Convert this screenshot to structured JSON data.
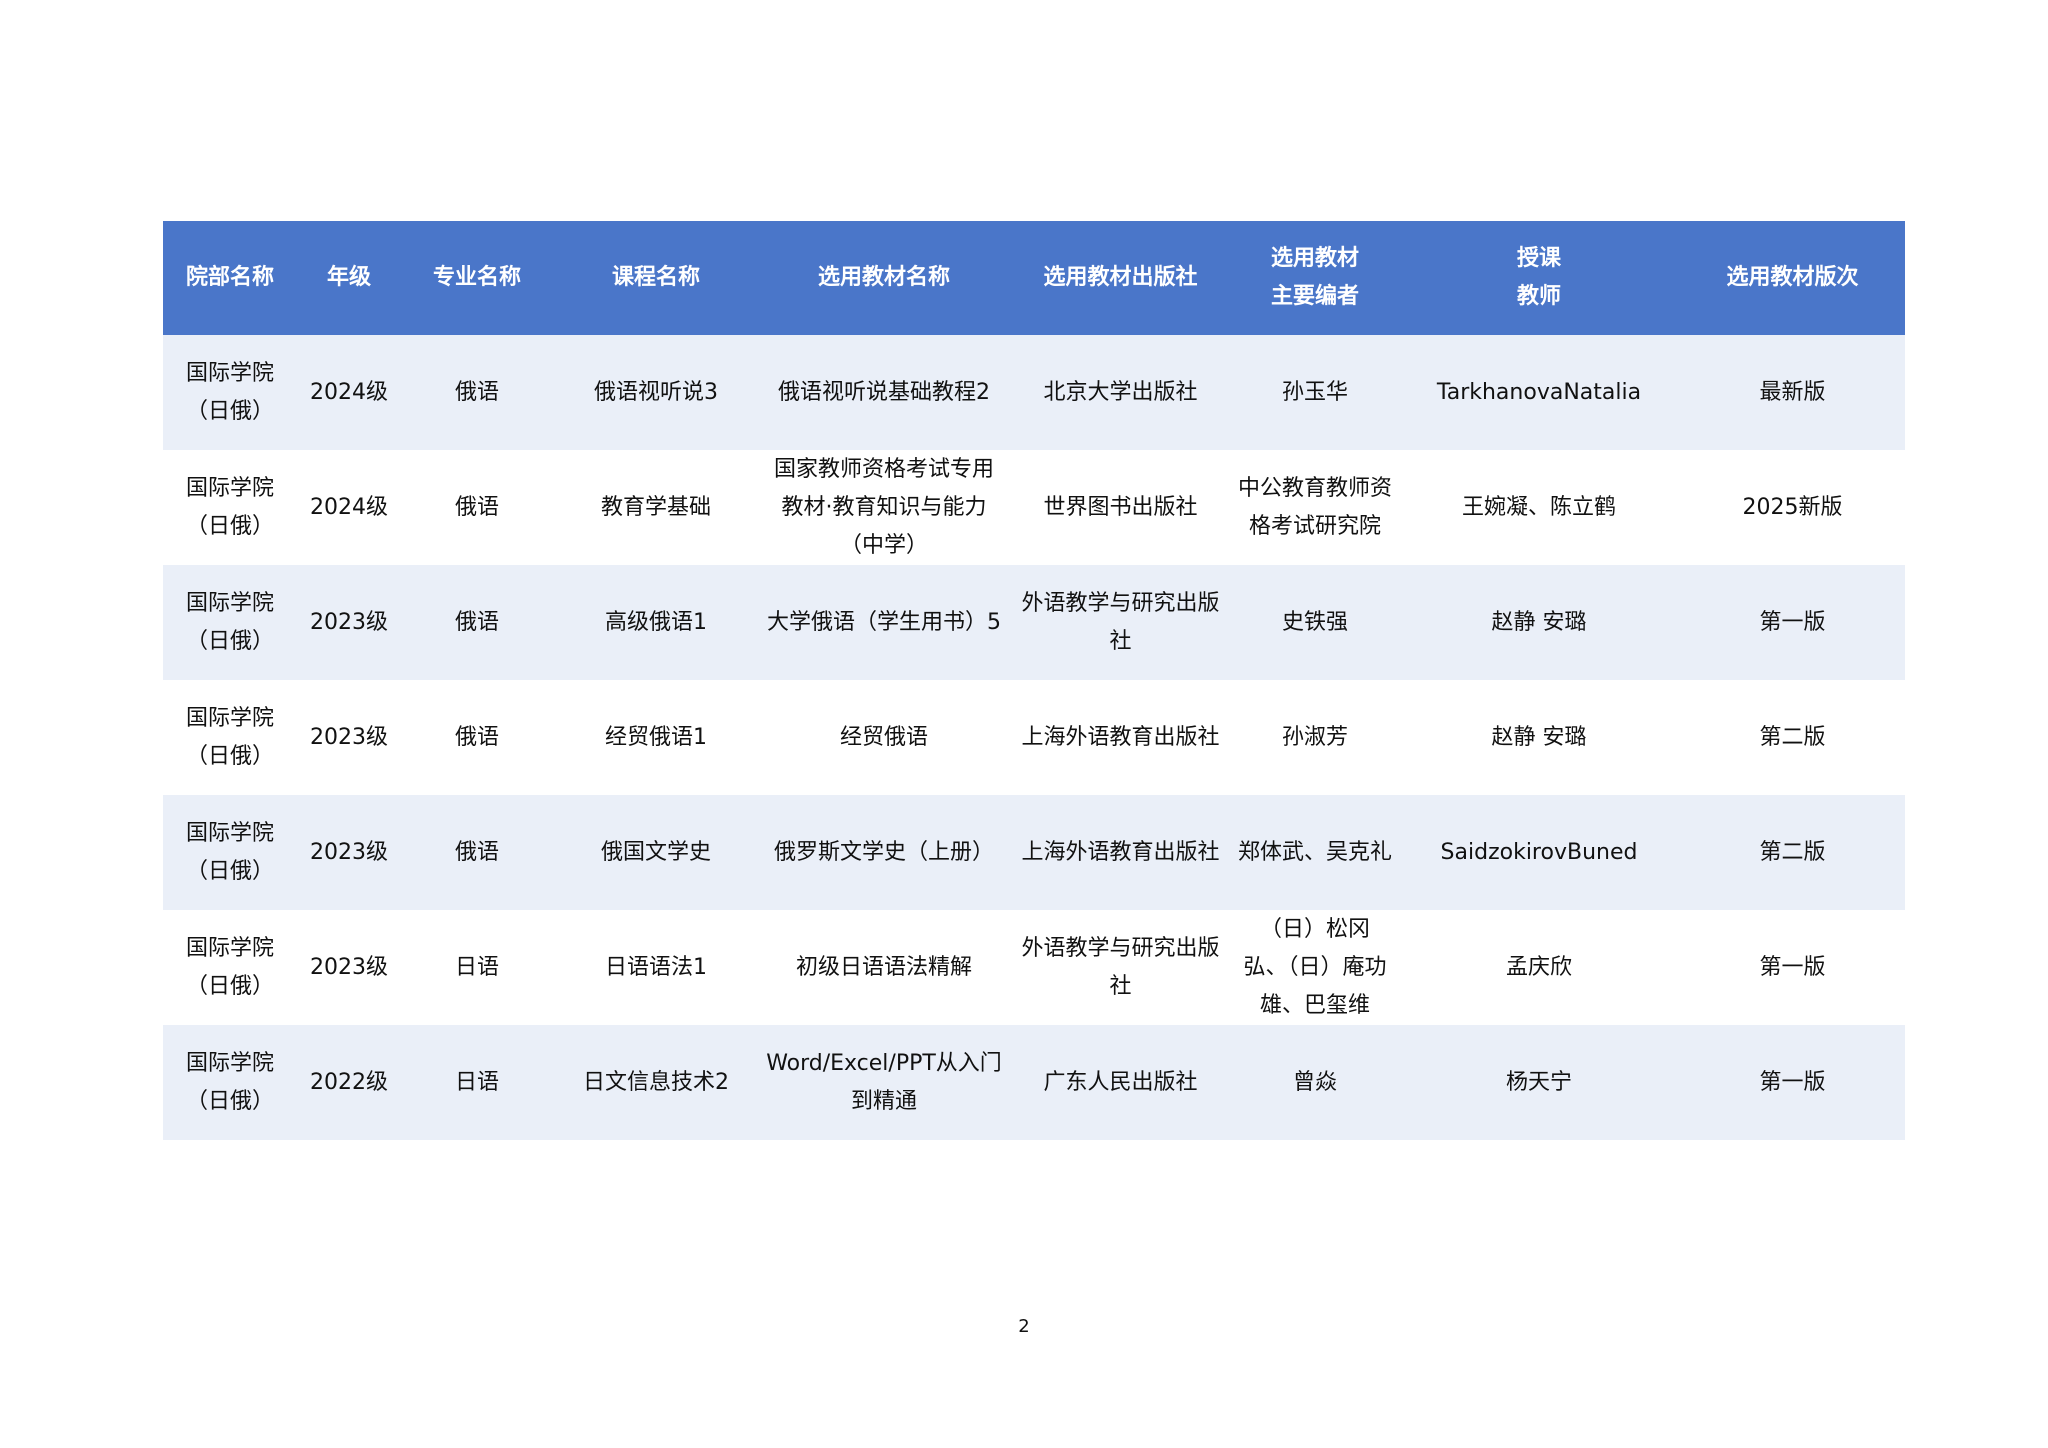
{
  "table": {
    "headers": [
      "院部名称",
      "年级",
      "专业名称",
      "课程名称",
      "选用教材名称",
      "选用教材出版社",
      "选用教材\n主要编者",
      "授课\n教师",
      "选用教材版次"
    ],
    "rows": [
      [
        "国际学院（日俄）",
        "2024级",
        "俄语",
        "俄语视听说3",
        "俄语视听说基础教程2",
        "北京大学出版社",
        "孙玉华",
        "TarkhanovaNatalia",
        "最新版"
      ],
      [
        "国际学院（日俄）",
        "2024级",
        "俄语",
        "教育学基础",
        "国家教师资格考试专用教材·教育知识与能力（中学）",
        "世界图书出版社",
        "中公教育教师资格考试研究院",
        "王婉凝、陈立鹤",
        "2025新版"
      ],
      [
        "国际学院（日俄）",
        "2023级",
        "俄语",
        "高级俄语1",
        "大学俄语（学生用书）5",
        "外语教学与研究出版社",
        "史铁强",
        "赵静 安璐",
        "第一版"
      ],
      [
        "国际学院（日俄）",
        "2023级",
        "俄语",
        "经贸俄语1",
        "经贸俄语",
        "上海外语教育出版社",
        "孙淑芳",
        "赵静 安璐",
        "第二版"
      ],
      [
        "国际学院（日俄）",
        "2023级",
        "俄语",
        "俄国文学史",
        "俄罗斯文学史（上册）",
        "上海外语教育出版社",
        "郑体武、吴克礼",
        "SaidzokirovBuned",
        "第二版"
      ],
      [
        "国际学院（日俄）",
        "2023级",
        "日语",
        "日语语法1",
        "初级日语语法精解",
        "外语教学与研究出版社",
        "（日）松冈弘、（日）庵功雄、巴玺维",
        "孟庆欣",
        "第一版"
      ],
      [
        "国际学院（日俄）",
        "2022级",
        "日语",
        "日文信息技术2",
        "Word/Excel/PPT从入门到精通",
        "广东人民出版社",
        "曾焱",
        "杨天宁",
        "第一版"
      ]
    ]
  },
  "footer": {
    "page_number": "2"
  },
  "colors": {
    "header_bg": "#4a76c9",
    "row_band": "#eaeff8"
  }
}
